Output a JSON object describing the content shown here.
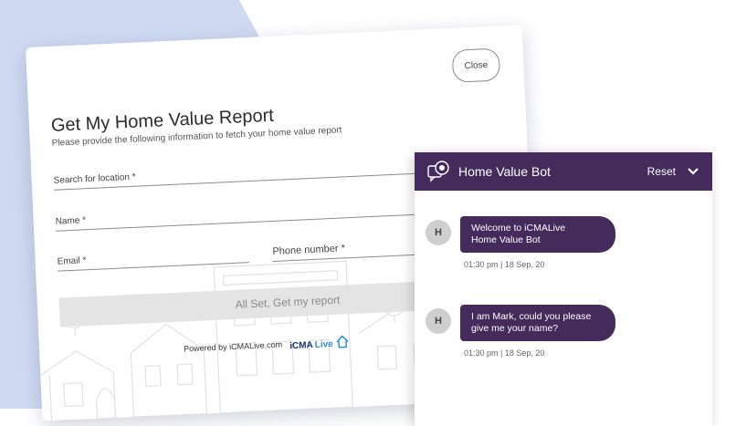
{
  "form": {
    "close_label": "Close",
    "title": "Get My Home Value Report",
    "subtitle": "Please provide the following information to fetch your home value report",
    "location_label": "Search for location *",
    "name_label": "Name *",
    "email_label": "Email *",
    "phone_label": "Phone number *",
    "submit_label": "All Set, Get my report",
    "powered_by": "Powered by iCMALive.com",
    "logo_text_1": "iCMA",
    "logo_text_2": "Live"
  },
  "chat": {
    "title": "Home Value Bot",
    "reset_label": "Reset",
    "messages": [
      {
        "avatar": "H",
        "line1": "Welcome to iCMALive",
        "line2": "Home Value Bot",
        "time": "01:30 pm | 18 Sep, 20"
      },
      {
        "avatar": "H",
        "line1": "I am Mark, could you please",
        "line2": "give me your name?",
        "time": "01:30 pm | 18 Sep, 20"
      }
    ]
  },
  "colors": {
    "accent": "#452a5c",
    "background_shape": "#cfdaf2"
  },
  "icons": {
    "bot": "chat-bot-icon",
    "collapse": "chevron-down-icon"
  }
}
